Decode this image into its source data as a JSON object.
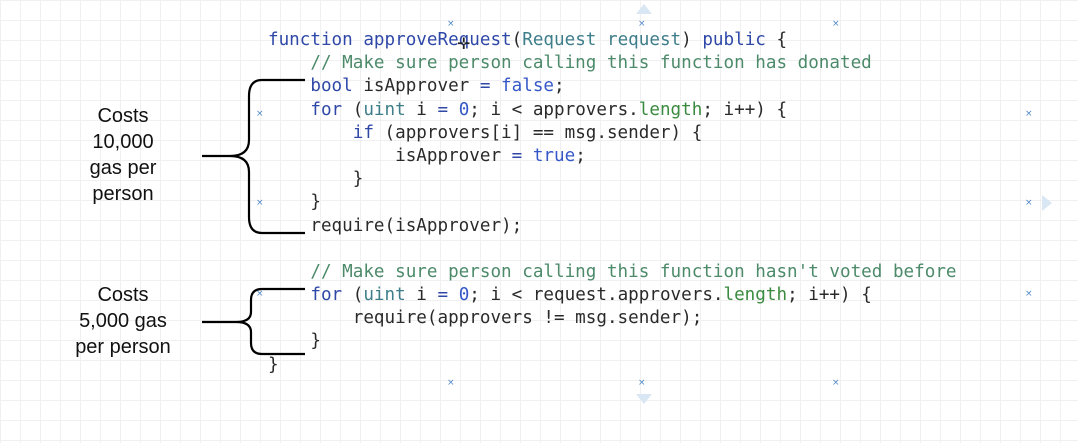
{
  "code_lines": [
    [
      [
        "kw",
        "function"
      ],
      [
        "pl",
        " "
      ],
      [
        "kw",
        "approveRequest"
      ],
      [
        "pl",
        "("
      ],
      [
        "ty",
        "Request"
      ],
      [
        "pl",
        " "
      ],
      [
        "ty",
        "request"
      ],
      [
        "pl",
        ") "
      ],
      [
        "kw",
        "public"
      ],
      [
        "pl",
        " {"
      ]
    ],
    [
      [
        "pl",
        "    "
      ],
      [
        "cm",
        "// Make sure person calling this function has donated"
      ]
    ],
    [
      [
        "pl",
        "    "
      ],
      [
        "kw",
        "bool"
      ],
      [
        "pl",
        " isApprover "
      ],
      [
        "kw",
        "="
      ],
      [
        "pl",
        " "
      ],
      [
        "lit",
        "false"
      ],
      [
        "pl",
        ";"
      ]
    ],
    [
      [
        "pl",
        "    "
      ],
      [
        "kw",
        "for"
      ],
      [
        "pl",
        " ("
      ],
      [
        "ty",
        "uint"
      ],
      [
        "pl",
        " i "
      ],
      [
        "kw",
        "="
      ],
      [
        "pl",
        " "
      ],
      [
        "lit",
        "0"
      ],
      [
        "pl",
        "; i < approvers."
      ],
      [
        "mb",
        "length"
      ],
      [
        "pl",
        "; i++) {"
      ]
    ],
    [
      [
        "pl",
        "        "
      ],
      [
        "kw",
        "if"
      ],
      [
        "pl",
        " (approvers[i] == msg.sender) {"
      ]
    ],
    [
      [
        "pl",
        "            isApprover "
      ],
      [
        "kw",
        "="
      ],
      [
        "pl",
        " "
      ],
      [
        "lit",
        "true"
      ],
      [
        "pl",
        ";"
      ]
    ],
    [
      [
        "pl",
        "        }"
      ]
    ],
    [
      [
        "pl",
        "    }"
      ]
    ],
    [
      [
        "pl",
        "    require(isApprover);"
      ]
    ],
    [
      [
        "pl",
        ""
      ]
    ],
    [
      [
        "pl",
        "    "
      ],
      [
        "cm",
        "// Make sure person calling this function hasn't voted before"
      ]
    ],
    [
      [
        "pl",
        "    "
      ],
      [
        "kw",
        "for"
      ],
      [
        "pl",
        " ("
      ],
      [
        "ty",
        "uint"
      ],
      [
        "pl",
        " i "
      ],
      [
        "kw",
        "="
      ],
      [
        "pl",
        " "
      ],
      [
        "lit",
        "0"
      ],
      [
        "pl",
        "; i < request.approvers."
      ],
      [
        "mb",
        "length"
      ],
      [
        "pl",
        "; i++) {"
      ]
    ],
    [
      [
        "pl",
        "        require(approvers != msg.sender);"
      ]
    ],
    [
      [
        "pl",
        "    }"
      ]
    ],
    [
      [
        "pl",
        "}"
      ]
    ]
  ],
  "annotations": {
    "first": [
      "Costs",
      "10,000",
      "gas per",
      "person"
    ],
    "second": [
      "Costs",
      "5,000 gas",
      "per person"
    ]
  },
  "colors": {
    "keyword": "#2f48a8",
    "comment": "#4c8a6a",
    "type": "#3e7e8a",
    "member": "#3a8b40",
    "literal": "#3558c8",
    "bracket": "#000000",
    "grid": "#f0f0f0",
    "marker": "#4d86c6"
  },
  "icons": {
    "marker": "×",
    "cursor": "✛"
  }
}
